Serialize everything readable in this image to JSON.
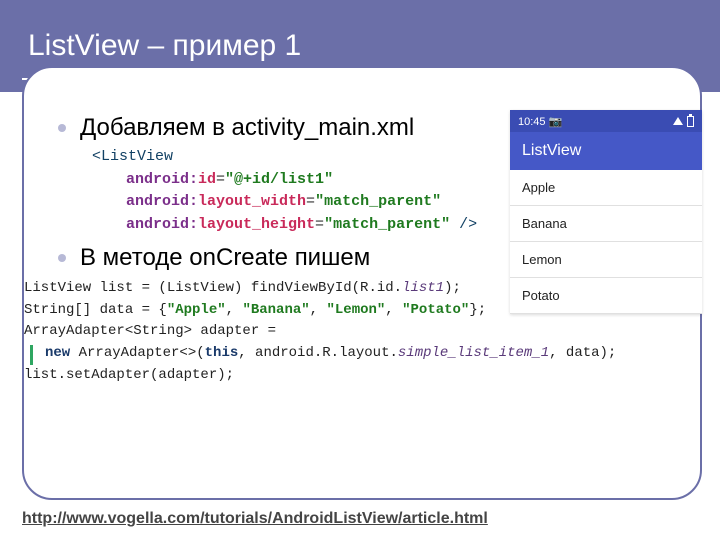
{
  "header": {
    "title": "ListView – пример 1"
  },
  "bullets": {
    "b1": "Добавляем в activity_main.xml",
    "b2": "В методе onCreate пишем"
  },
  "xml": {
    "open": "<ListView",
    "ns": "android:",
    "a1": "id",
    "v1": "\"@+id/list1\"",
    "a2": "layout_width",
    "v2": "\"match_parent\"",
    "a3": "layout_height",
    "v3": "\"match_parent\"",
    "close": " />"
  },
  "java": {
    "l1a": "ListView list = (ListView) findViewById(R.id.",
    "l1b": "list1",
    "l1c": ");",
    "l2a": "String[] data = {",
    "l2s1": "\"Apple\"",
    "l2s2": "\"Banana\"",
    "l2s3": "\"Lemon\"",
    "l2s4": "\"Potato\"",
    "l2b": "};",
    "l3": "ArrayAdapter<String> adapter =",
    "l4a": "new",
    "l4b": " ArrayAdapter<>(",
    "l4c": "this",
    "l4d": ", android.R.layout.",
    "l4e": "simple_list_item_1",
    "l4f": ", data);",
    "l5": "list.setAdapter(adapter);"
  },
  "phone": {
    "time": "10:45",
    "camera_glyph": "📷",
    "app_title": "ListView",
    "items": {
      "i0": "Apple",
      "i1": "Banana",
      "i2": "Lemon",
      "i3": "Potato"
    }
  },
  "footer": {
    "url": "http://www.vogella.com/tutorials/AndroidListView/article.html"
  }
}
